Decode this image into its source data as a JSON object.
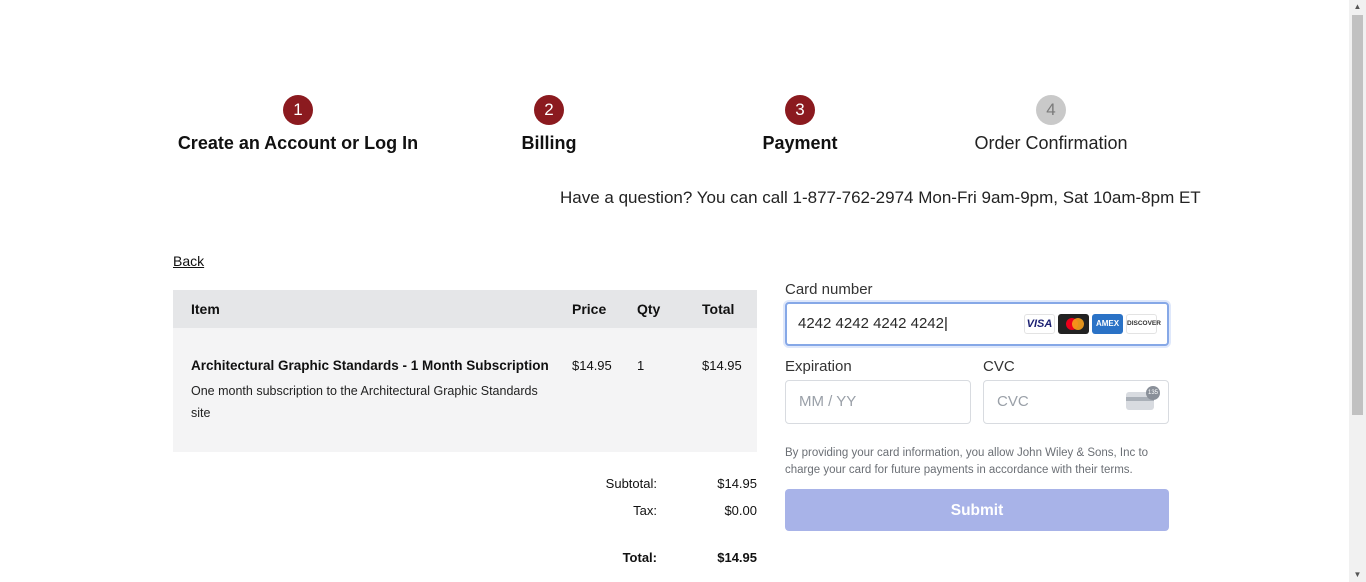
{
  "steps": [
    {
      "number": "1",
      "label": "Create an Account or Log In",
      "state": "complete"
    },
    {
      "number": "2",
      "label": "Billing",
      "state": "complete"
    },
    {
      "number": "3",
      "label": "Payment",
      "state": "current"
    },
    {
      "number": "4",
      "label": "Order Confirmation",
      "state": "pending"
    }
  ],
  "question": "Have a question? You can call 1-877-762-2974 Mon-Fri 9am-9pm, Sat 10am-8pm ET",
  "back_label": "Back",
  "cart": {
    "headers": {
      "item": "Item",
      "price": "Price",
      "qty": "Qty",
      "total": "Total"
    },
    "items": [
      {
        "name": "Architectural Graphic Standards - 1 Month Subscription",
        "description": "One month subscription to the Architectural Graphic Standards site",
        "price": "$14.95",
        "qty": "1",
        "total": "$14.95"
      }
    ],
    "summary": {
      "subtotal_label": "Subtotal:",
      "subtotal": "$14.95",
      "tax_label": "Tax:",
      "tax": "$0.00",
      "total_label": "Total:",
      "total": "$14.95"
    }
  },
  "payment": {
    "card_number_label": "Card number",
    "card_number_value": "4242 4242 4242 4242",
    "card_brands": [
      "VISA",
      "AMEX",
      "DISCOVER"
    ],
    "expiration_label": "Expiration",
    "expiration_placeholder": "MM / YY",
    "cvc_label": "CVC",
    "cvc_placeholder": "CVC",
    "cvc_badge": "135",
    "legal_text": "By providing your card information, you allow John Wiley & Sons, Inc to charge your card for future payments in accordance with their terms.",
    "submit_label": "Submit"
  },
  "colors": {
    "step_active": "#8b1a1f",
    "step_inactive": "#c9c9c9",
    "submit_bg": "#a8b3e8",
    "focus_border": "#86a8e7"
  }
}
